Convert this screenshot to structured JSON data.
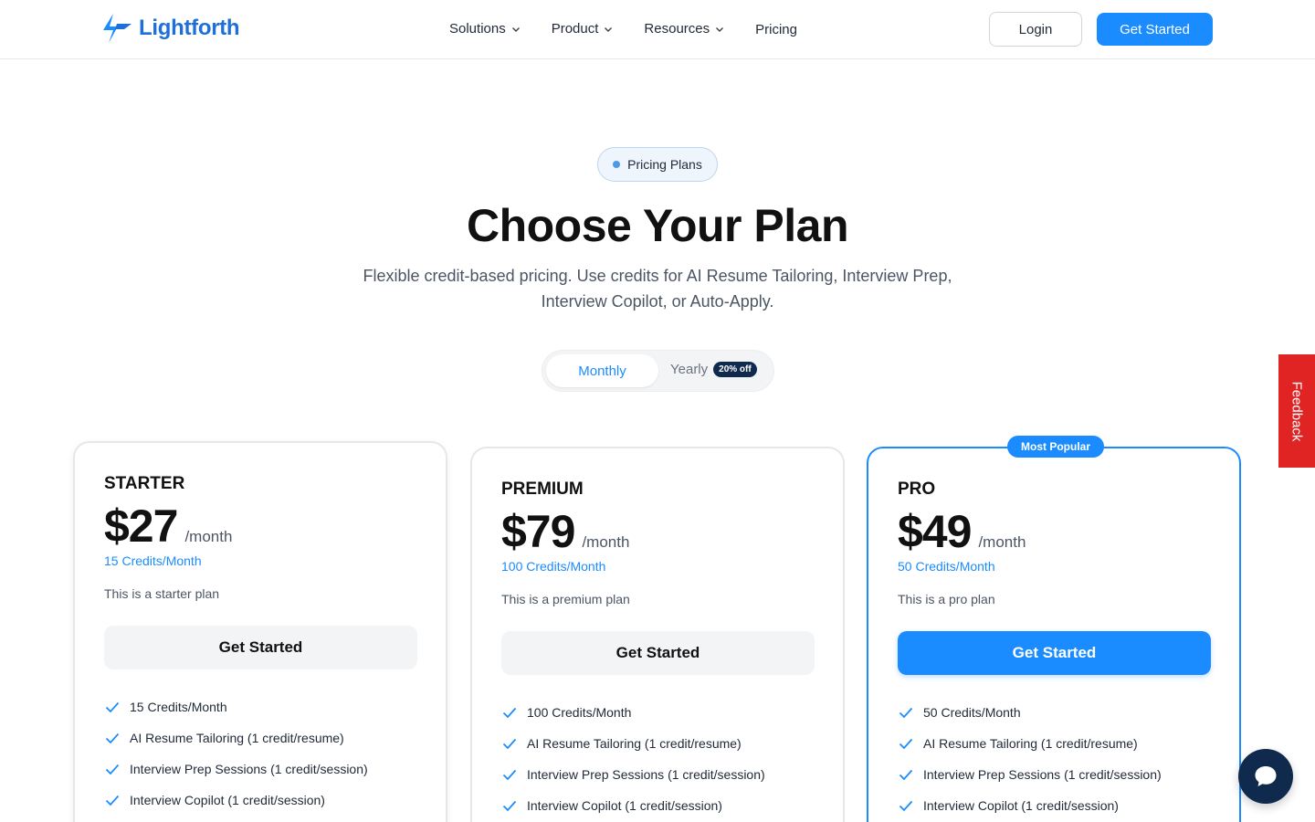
{
  "header": {
    "brand": "Lightforth",
    "nav": [
      {
        "label": "Solutions",
        "dropdown": true
      },
      {
        "label": "Product",
        "dropdown": true
      },
      {
        "label": "Resources",
        "dropdown": true
      },
      {
        "label": "Pricing",
        "dropdown": false
      }
    ],
    "login_label": "Login",
    "cta_label": "Get Started"
  },
  "hero": {
    "badge": "Pricing Plans",
    "title": "Choose Your Plan",
    "subtitle": "Flexible credit-based pricing. Use credits for AI Resume Tailoring, Interview Prep, Interview Copilot, or Auto-Apply."
  },
  "billing_toggle": {
    "monthly": "Monthly",
    "yearly": "Yearly",
    "yearly_badge": "20% off",
    "selected": "Monthly"
  },
  "plans": [
    {
      "name": "STARTER",
      "price": "$27",
      "period": "/month",
      "credits": "15 Credits/Month",
      "description": "This is a starter plan",
      "button": "Get Started",
      "features": [
        "15 Credits/Month",
        "AI Resume Tailoring (1 credit/resume)",
        "Interview Prep Sessions (1 credit/session)",
        "Interview Copilot (1 credit/session)"
      ]
    },
    {
      "name": "PREMIUM",
      "price": "$79",
      "period": "/month",
      "credits": "100 Credits/Month",
      "description": "This is a premium plan",
      "button": "Get Started",
      "features": [
        "100 Credits/Month",
        "AI Resume Tailoring (1 credit/resume)",
        "Interview Prep Sessions (1 credit/session)",
        "Interview Copilot (1 credit/session)"
      ]
    },
    {
      "name": "PRO",
      "badge": "Most Popular",
      "price": "$49",
      "period": "/month",
      "credits": "50 Credits/Month",
      "description": "This is a pro plan",
      "button": "Get Started",
      "features": [
        "50 Credits/Month",
        "AI Resume Tailoring (1 credit/resume)",
        "Interview Prep Sessions (1 credit/session)",
        "Interview Copilot (1 credit/session)"
      ]
    }
  ],
  "feedback_label": "Feedback",
  "colors": {
    "accent": "#1a8cff",
    "brand": "#1e6fd9",
    "feedback": "#e02424",
    "chat": "#0f2a4d"
  }
}
